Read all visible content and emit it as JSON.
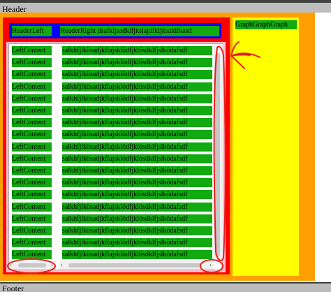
{
  "header": {
    "title": "Header"
  },
  "footer": {
    "title": "Footer"
  },
  "graph": {
    "label": "GraphGraphGraph"
  },
  "table_header": {
    "left": "HeaderLeft",
    "right": "HeaderRight   dsafkljsadklfjkslajdfkljksaldfkasd"
  },
  "rows": [
    {
      "left": "LeftContent",
      "right": "salkhfjlkösadjkflajsklödfjklösdklfjslködafsdf"
    },
    {
      "left": "LeftContent",
      "right": "salkhfjlkösadjkflajsklödfjklösdklfjslködafsdf"
    },
    {
      "left": "LeftContent",
      "right": "salkhfjlkösadjkflajsklödfjklösdklfjslködafsdf"
    },
    {
      "left": "LeftContent",
      "right": "salkhfjlkösadjkflajsklödfjklösdklfjslködafsdf"
    },
    {
      "left": "LeftContent",
      "right": "salkhfjlkösadjkflajsklödfjklösdklfjslködafsdf"
    },
    {
      "left": "LeftContent",
      "right": "salkhfjlkösadjkflajsklödfjklösdklfjslködafsdf"
    },
    {
      "left": "LeftContent",
      "right": "salkhfjlkösadjkflajsklödfjklösdklfjslködafsdf"
    },
    {
      "left": "LeftContent",
      "right": "salkhfjlkösadjkflajsklödfjklösdklfjslködafsdf"
    },
    {
      "left": "LeftContent",
      "right": "salkhfjlkösadjkflajsklödfjklösdklfjslködafsdf"
    },
    {
      "left": "LeftContent",
      "right": "salkhfjlkösadjkflajsklödfjklösdklfjslködafsdf"
    },
    {
      "left": "LeftContent",
      "right": "salkhfjlkösadjkflajsklödfjklösdklfjslködafsdf"
    },
    {
      "left": "LeftContent",
      "right": "salkhfjlkösadjkflajsklödfjklösdklfjslködafsdf"
    },
    {
      "left": "LeftContent",
      "right": "salkhfjlkösadjkflajsklödfjklösdklfjslködafsdf"
    },
    {
      "left": "LeftContent",
      "right": "salkhfjlkösadjkflajsklödfjklösdklfjslködafsdf"
    },
    {
      "left": "LeftContent",
      "right": "salkhfjlkösadjkflajsklödfjklösdklfjslködafsdf"
    },
    {
      "left": "LeftContent",
      "right": "salkhfjlkösadjkflajsklödfjklösdklfjslködafsdf"
    },
    {
      "left": "LeftContent",
      "right": "salkhfjlkösadjkflajsklödfjklösdklfjslködafsdf"
    },
    {
      "left": "LeftContent",
      "right": "salkhfjlkösadjkflajsklödfjklösdklfjslködafsdf"
    }
  ],
  "colors": {
    "page_background": "#ffffff",
    "header_footer": "#bdbdbd",
    "outer_container": "#ff9f00",
    "graph_panel": "#ffff00",
    "table_frame": "#ff0000",
    "header_row": "#0000ff",
    "cell": "#11aa11",
    "table_background": "#ffc0cb",
    "annotation": "#e8201c"
  },
  "icons": {
    "scroll_up": "chevron-up-icon",
    "scroll_down": "chevron-down-icon",
    "scroll_left": "chevron-left-icon",
    "scroll_right": "chevron-right-icon",
    "annotation_arrow": "arrow-annotation-icon"
  }
}
